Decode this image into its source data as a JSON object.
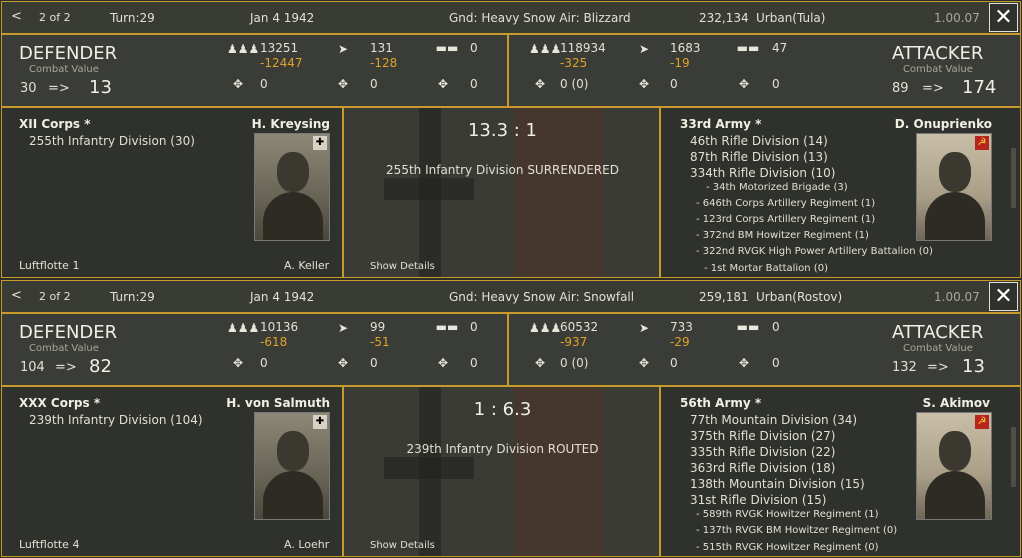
{
  "reports": [
    {
      "nav": {
        "prev": "<",
        "page": "2 of 2"
      },
      "turn": "Turn:29",
      "date": "Jan 4 1942",
      "weather": "Gnd: Heavy Snow  Air: Blizzard",
      "men": "232,134",
      "terrain": "Urban(Tula)",
      "version": "1.00.07",
      "close": "✕",
      "defender": {
        "title": "DEFENDER",
        "cv_label": "Combat Value",
        "cv_start": "30",
        "arrow": "=>",
        "cv_end": "13",
        "men": "13251",
        "men_loss": "-12447",
        "guns": "131",
        "guns_loss": "-128",
        "tanks": "0",
        "fighters": "0",
        "bombers": "0",
        "recon": "0"
      },
      "attacker": {
        "title": "ATTACKER",
        "cv_label": "Combat Value",
        "cv_start": "89",
        "arrow": "=>",
        "cv_end": "174",
        "men": "118934",
        "men_loss": "-325",
        "guns": "1683",
        "guns_loss": "-19",
        "tanks": "47",
        "fighters": "0 (0)",
        "bombers": "0",
        "recon": "0"
      },
      "def_units": {
        "hq": "XII Corps *",
        "commander": "H. Kreysing",
        "units": [
          "255th Infantry Division (30)"
        ],
        "cut_left": "Luftflotte 1",
        "cut_right": "A. Keller"
      },
      "battle": {
        "ratio": "13.3 : 1",
        "result": "255th Infantry Division SURRENDERED",
        "details": "Show Details"
      },
      "att_units": {
        "hq": "33rd Army *",
        "commander": "D. Onuprienko",
        "units": [
          "46th Rifle Division (14)",
          "87th Rifle Division (13)",
          "334th Rifle Division (10)"
        ],
        "subunits": [
          "- 34th Motorized Brigade (3)",
          "- 646th Corps Artillery Regiment (1)",
          "- 123rd Corps Artillery Regiment (1)",
          "- 372nd BM Howitzer Regiment (1)",
          "- 322nd RVGK High Power Artillery Battalion (0)"
        ],
        "cut": "- 1st Mortar Battalion (0)"
      }
    },
    {
      "nav": {
        "prev": "<",
        "page": "2 of 2"
      },
      "turn": "Turn:29",
      "date": "Jan 4 1942",
      "weather": "Gnd: Heavy Snow  Air: Snowfall",
      "men": "259,181",
      "terrain": "Urban(Rostov)",
      "version": "1.00.07",
      "close": "✕",
      "defender": {
        "title": "DEFENDER",
        "cv_label": "Combat Value",
        "cv_start": "104",
        "arrow": "=>",
        "cv_end": "82",
        "men": "10136",
        "men_loss": "-618",
        "guns": "99",
        "guns_loss": "-51",
        "tanks": "0",
        "fighters": "0",
        "bombers": "0",
        "recon": "0"
      },
      "attacker": {
        "title": "ATTACKER",
        "cv_label": "Combat Value",
        "cv_start": "132",
        "arrow": "=>",
        "cv_end": "13",
        "men": "60532",
        "men_loss": "-937",
        "guns": "733",
        "guns_loss": "-29",
        "tanks": "0",
        "fighters": "0 (0)",
        "bombers": "0",
        "recon": "0"
      },
      "def_units": {
        "hq": "XXX Corps *",
        "commander": "H. von Salmuth",
        "units": [
          "239th Infantry Division (104)"
        ],
        "cut_left": "Luftflotte 4",
        "cut_right": "A. Loehr"
      },
      "battle": {
        "ratio": "1 : 6.3",
        "result": "239th Infantry Division ROUTED",
        "details": "Show Details"
      },
      "att_units": {
        "hq": "56th Army *",
        "commander": "S. Akimov",
        "units": [
          "77th Mountain Division (34)",
          "375th Rifle Division (27)",
          "335th Rifle Division (22)",
          "363rd Rifle Division (18)",
          "138th Mountain Division (15)",
          "31st Rifle Division (15)"
        ],
        "subunits": [
          "- 589th RVGK Howitzer Regiment (1)",
          "- 137th RVGK BM Howitzer Regiment (0)"
        ],
        "cut": "- 515th RVGK Howitzer Regiment (0)"
      }
    }
  ]
}
